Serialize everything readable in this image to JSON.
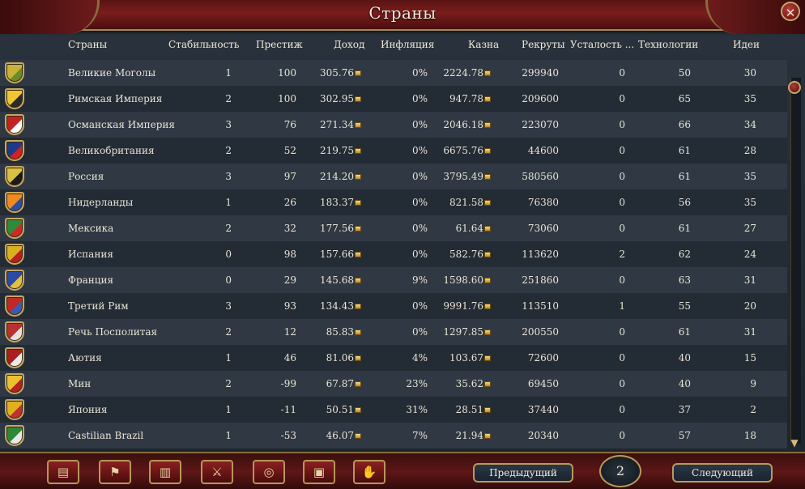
{
  "window": {
    "title": "Страны",
    "close_glyph": "✕"
  },
  "columns": [
    "Страны",
    "Стабильность",
    "Престиж",
    "Доход",
    "Инфляция",
    "Казна",
    "Рекруты",
    "Усталость ...",
    "Технологии",
    "Идеи"
  ],
  "rows": [
    {
      "flag": [
        "#c9b23a",
        "#6a8c2a"
      ],
      "name": "Великие Моголы",
      "stability": "1",
      "prestige": "100",
      "income": "305.76",
      "inflation": "0%",
      "treasury": "2224.78",
      "manpower": "299940",
      "war_exhaustion": "0",
      "tech": "50",
      "ideas": "30"
    },
    {
      "flag": [
        "#f0c630",
        "#2a2a2a"
      ],
      "name": "Римская Империя",
      "stability": "2",
      "prestige": "100",
      "income": "302.95",
      "inflation": "0%",
      "treasury": "947.78",
      "manpower": "209600",
      "war_exhaustion": "0",
      "tech": "65",
      "ideas": "35"
    },
    {
      "flag": [
        "#c42222",
        "#ffffff"
      ],
      "name": "Османская Империя",
      "stability": "3",
      "prestige": "76",
      "income": "271.34",
      "inflation": "0%",
      "treasury": "2046.18",
      "manpower": "223070",
      "war_exhaustion": "0",
      "tech": "66",
      "ideas": "34"
    },
    {
      "flag": [
        "#1f3a8a",
        "#d62020"
      ],
      "name": "Великобритания",
      "stability": "2",
      "prestige": "52",
      "income": "219.75",
      "inflation": "0%",
      "treasury": "6675.76",
      "manpower": "44600",
      "war_exhaustion": "0",
      "tech": "61",
      "ideas": "28"
    },
    {
      "flag": [
        "#d8c040",
        "#1a1a1a"
      ],
      "name": "Россия",
      "stability": "3",
      "prestige": "97",
      "income": "214.20",
      "inflation": "0%",
      "treasury": "3795.49",
      "manpower": "580560",
      "war_exhaustion": "0",
      "tech": "61",
      "ideas": "35"
    },
    {
      "flag": [
        "#f08a20",
        "#2a4fa0"
      ],
      "name": "Нидерланды",
      "stability": "1",
      "prestige": "26",
      "income": "183.37",
      "inflation": "0%",
      "treasury": "821.58",
      "manpower": "76380",
      "war_exhaustion": "0",
      "tech": "56",
      "ideas": "35"
    },
    {
      "flag": [
        "#2f8a3a",
        "#d02828"
      ],
      "name": "Мексика",
      "stability": "2",
      "prestige": "32",
      "income": "177.56",
      "inflation": "0%",
      "treasury": "61.64",
      "manpower": "73060",
      "war_exhaustion": "0",
      "tech": "61",
      "ideas": "27"
    },
    {
      "flag": [
        "#d8b020",
        "#b82020"
      ],
      "name": "Испания",
      "stability": "0",
      "prestige": "98",
      "income": "157.66",
      "inflation": "0%",
      "treasury": "582.76",
      "manpower": "113620",
      "war_exhaustion": "2",
      "tech": "62",
      "ideas": "24"
    },
    {
      "flag": [
        "#2a4aa8",
        "#e0c040"
      ],
      "name": "Франция",
      "stability": "0",
      "prestige": "29",
      "income": "145.68",
      "inflation": "9%",
      "treasury": "1598.60",
      "manpower": "251860",
      "war_exhaustion": "0",
      "tech": "63",
      "ideas": "31"
    },
    {
      "flag": [
        "#c02828",
        "#3a5ab0"
      ],
      "name": "Третий Рим",
      "stability": "3",
      "prestige": "93",
      "income": "134.43",
      "inflation": "0%",
      "treasury": "9991.76",
      "manpower": "113510",
      "war_exhaustion": "1",
      "tech": "55",
      "ideas": "20"
    },
    {
      "flag": [
        "#b83030",
        "#e8e0e0"
      ],
      "name": "Речь Посполитая",
      "stability": "2",
      "prestige": "12",
      "income": "85.83",
      "inflation": "0%",
      "treasury": "1297.85",
      "manpower": "200550",
      "war_exhaustion": "0",
      "tech": "61",
      "ideas": "31"
    },
    {
      "flag": [
        "#a82020",
        "#f0e8e8"
      ],
      "name": "Аютия",
      "stability": "1",
      "prestige": "46",
      "income": "81.06",
      "inflation": "4%",
      "treasury": "103.67",
      "manpower": "72600",
      "war_exhaustion": "0",
      "tech": "40",
      "ideas": "15"
    },
    {
      "flag": [
        "#e8c030",
        "#b82020"
      ],
      "name": "Мин",
      "stability": "2",
      "prestige": "-99",
      "income": "67.87",
      "inflation": "23%",
      "treasury": "35.62",
      "manpower": "69450",
      "war_exhaustion": "0",
      "tech": "40",
      "ideas": "9"
    },
    {
      "flag": [
        "#e0b020",
        "#c03030"
      ],
      "name": "Япония",
      "stability": "1",
      "prestige": "-11",
      "income": "50.51",
      "inflation": "31%",
      "treasury": "28.51",
      "manpower": "37440",
      "war_exhaustion": "0",
      "tech": "37",
      "ideas": "2"
    },
    {
      "flag": [
        "#2a8a3a",
        "#e8e8e8"
      ],
      "name": "Castilian Brazil",
      "stability": "1",
      "prestige": "-53",
      "income": "46.07",
      "inflation": "7%",
      "treasury": "21.94",
      "manpower": "20340",
      "war_exhaustion": "0",
      "tech": "57",
      "ideas": "18"
    }
  ],
  "bottom_buttons": [
    {
      "name": "ledger-book-button",
      "icon": "book-icon",
      "glyph": "▤"
    },
    {
      "name": "flag-button",
      "icon": "flag-icon",
      "glyph": "⚑"
    },
    {
      "name": "buildings-button",
      "icon": "buildings-icon",
      "glyph": "▥"
    },
    {
      "name": "military-button",
      "icon": "crossed-swords-icon",
      "glyph": "⚔"
    },
    {
      "name": "economy-button",
      "icon": "coins-icon",
      "glyph": "◎"
    },
    {
      "name": "trade-button",
      "icon": "crate-icon",
      "glyph": "▣"
    },
    {
      "name": "diplomacy-button",
      "icon": "handshake-icon",
      "glyph": "✋"
    }
  ],
  "pagination": {
    "prev_label": "Предыдущий",
    "page": "2",
    "next_label": "Следующий"
  },
  "colors": {
    "title_bar": "#7a1c1c",
    "row_odd": "#2f3843",
    "row_even": "#232b34",
    "accent_gold": "#c6a96a"
  }
}
